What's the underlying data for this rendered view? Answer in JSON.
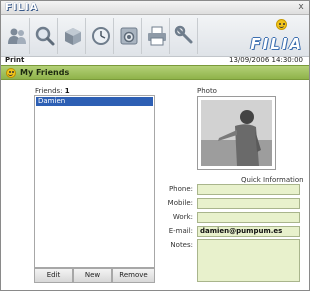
{
  "app": {
    "title": "FILIA",
    "brand": "FILIA",
    "close_label": "x"
  },
  "toolbar": {
    "buttons": [
      {
        "icon": "friends-icon"
      },
      {
        "icon": "search-icon"
      },
      {
        "icon": "box-icon"
      },
      {
        "icon": "clock-icon"
      },
      {
        "icon": "camera-icon"
      },
      {
        "icon": "printer-icon"
      },
      {
        "icon": "tools-icon"
      }
    ]
  },
  "status": {
    "section_label": "Print",
    "datetime": "13/09/2006 14:30:00"
  },
  "section": {
    "title": "My Friends"
  },
  "friends": {
    "label": "Friends:",
    "count": "1",
    "items": [
      "Damien"
    ],
    "buttons": {
      "edit": "Edit",
      "new": "New",
      "remove": "Remove"
    }
  },
  "photo": {
    "label": "Photo"
  },
  "quick_info": {
    "heading": "Quick Information",
    "fields": {
      "phone": {
        "label": "Phone:",
        "value": ""
      },
      "mobile": {
        "label": "Mobile:",
        "value": ""
      },
      "work": {
        "label": "Work:",
        "value": ""
      },
      "email": {
        "label": "E-mail:",
        "value": "damien@pumpum.es"
      },
      "notes": {
        "label": "Notes:",
        "value": ""
      }
    }
  },
  "colors": {
    "header_green": "#9dbf5b",
    "field_green": "#e8f1cc",
    "selection_blue": "#2d5fb4",
    "brand_blue": "#3d6fb0"
  }
}
